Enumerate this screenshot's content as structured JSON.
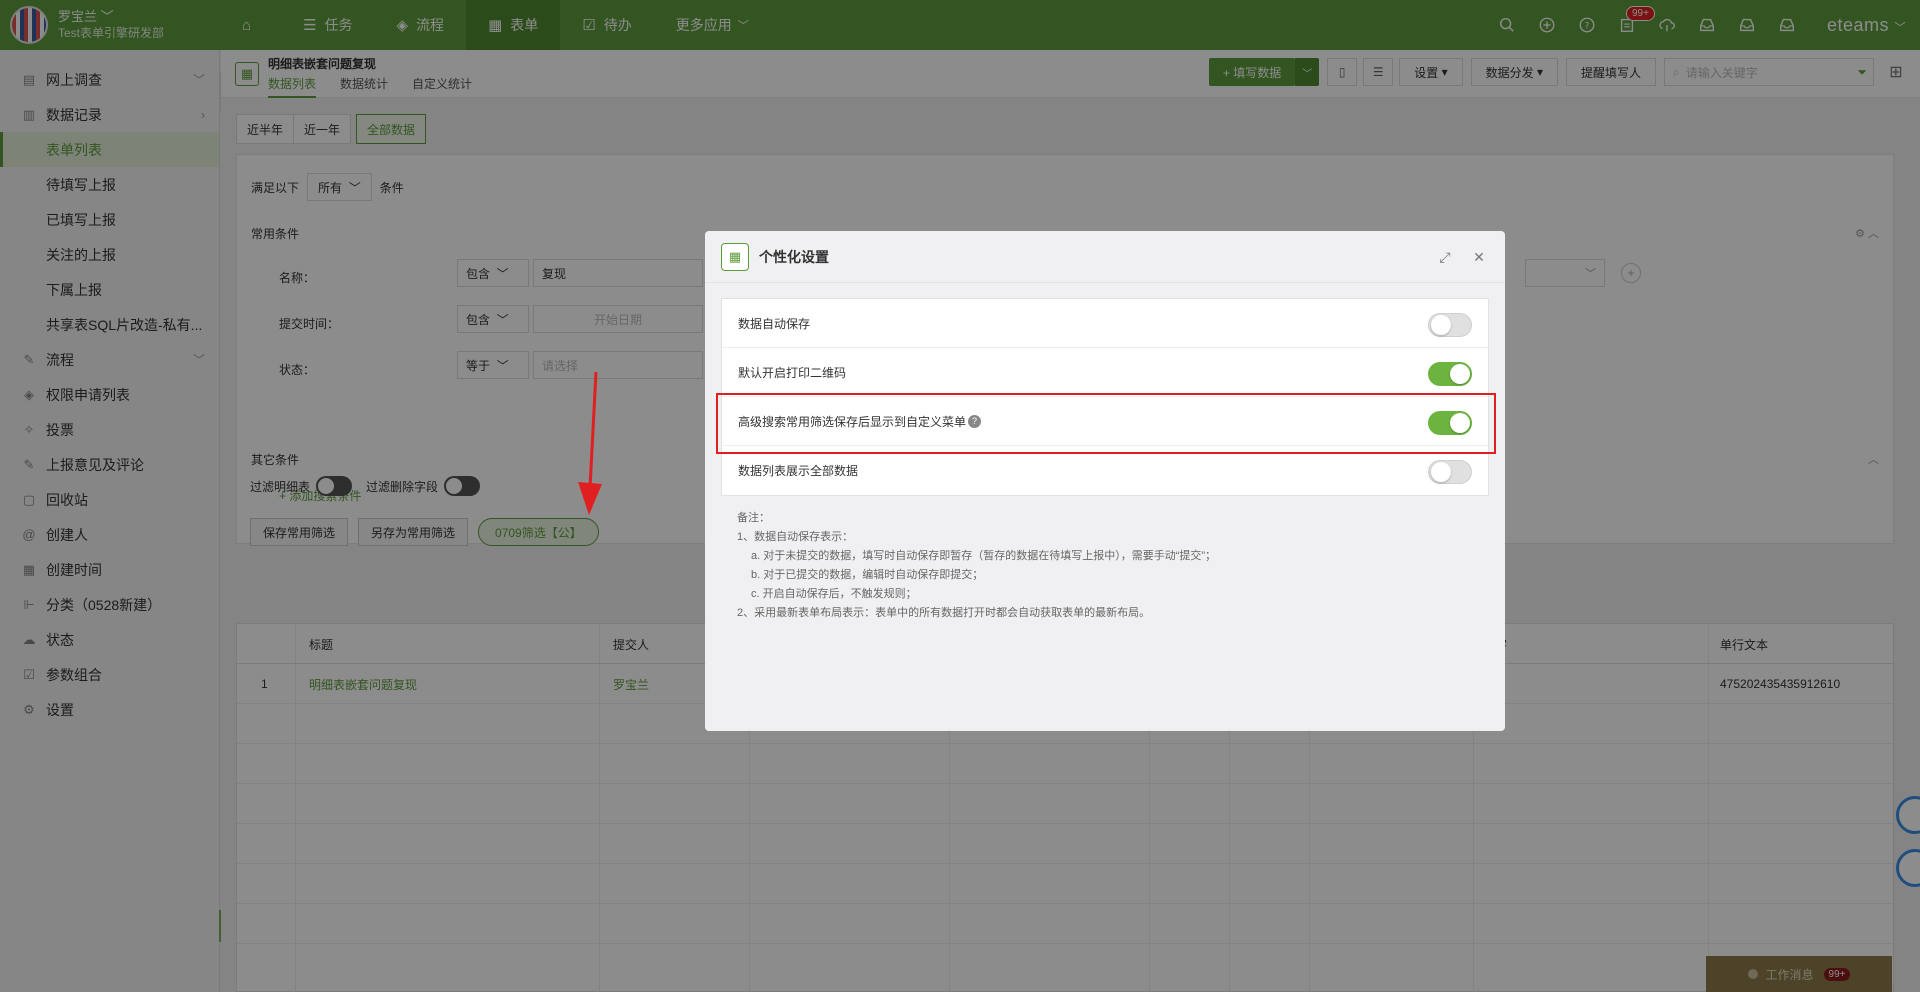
{
  "user": {
    "name": "罗宝兰",
    "dept": "Test表单引擎研发部"
  },
  "nav": [
    {
      "label": ""
    },
    {
      "label": "任务"
    },
    {
      "label": "流程"
    },
    {
      "label": "表单"
    },
    {
      "label": "待办"
    },
    {
      "label": "更多应用"
    }
  ],
  "top_badge": "99+",
  "brand": "eteams",
  "sidebar": [
    {
      "label": "网上调查",
      "icon": "survey-icon",
      "chevron": "﹀"
    },
    {
      "label": "数据记录",
      "icon": "records-icon",
      "chevron": "›"
    },
    {
      "label": "表单列表",
      "sub": true,
      "active": true
    },
    {
      "label": "待填写上报",
      "sub": true
    },
    {
      "label": "已填写上报",
      "sub": true
    },
    {
      "label": "关注的上报",
      "sub": true
    },
    {
      "label": "下属上报",
      "sub": true
    },
    {
      "label": "共享表SQL片改造-私有...",
      "sub": true
    },
    {
      "label": "流程",
      "icon": "flow-icon",
      "chevron": "﹀"
    },
    {
      "label": "权限申请列表",
      "icon": "layers-icon"
    },
    {
      "label": "投票",
      "icon": "vote-icon"
    },
    {
      "label": "上报意见及评论",
      "icon": "comment-icon"
    },
    {
      "label": "回收站",
      "icon": "trash-icon"
    },
    {
      "label": "创建人",
      "icon": "at-icon"
    },
    {
      "label": "创建时间",
      "icon": "calendar-icon"
    },
    {
      "label": "分类（0528新建）",
      "icon": "category-icon"
    },
    {
      "label": "状态",
      "icon": "cloud-icon"
    },
    {
      "label": "参数组合",
      "icon": "checkbox-icon"
    },
    {
      "label": "设置",
      "icon": "gear-icon"
    }
  ],
  "page": {
    "title": "明细表嵌套问题复现",
    "tabs": [
      "数据列表",
      "数据统计",
      "自定义统计"
    ],
    "fill_button": "+ 填写数据",
    "settings_button": "设置",
    "distribute_button": "数据分发",
    "remind_button": "提醒填写人",
    "search_placeholder": "请输入关键字"
  },
  "time_tabs": [
    "近半年",
    "近一年",
    "全部数据"
  ],
  "filter": {
    "satisfy_prefix": "满足以下",
    "satisfy_value": "所有",
    "satisfy_suffix": "条件",
    "common_title": "常用条件",
    "rows": [
      {
        "label": "名称：",
        "op": "包含",
        "value": "复现"
      },
      {
        "label": "提交时间：",
        "op": "包含",
        "value": "开始日期"
      },
      {
        "label": "状态：",
        "op": "等于",
        "value": "请选择"
      }
    ],
    "other_title": "其它条件",
    "add_condition": "+ 添加搜索条件",
    "filter_detail": "过滤明细表",
    "filter_deleted": "过滤删除字段",
    "save_common": "保存常用筛选",
    "save_as_common": "另存为常用筛选",
    "saved_filter": "0709筛选【公】"
  },
  "grid": {
    "columns": [
      "标题",
      "提交人",
      "数字",
      "单行文本"
    ],
    "rows": [
      {
        "index": "1",
        "title": "明细表嵌套问题复现",
        "submitter": "罗宝兰",
        "text": "475202435435912610"
      }
    ]
  },
  "modal": {
    "title": "个性化设置",
    "settings": [
      {
        "label": "数据自动保存",
        "on": false,
        "help": false
      },
      {
        "label": "默认开启打印二维码",
        "on": true,
        "help": false
      },
      {
        "label": "高级搜索常用筛选保存后显示到自定义菜单",
        "on": true,
        "help": true
      },
      {
        "label": "数据列表展示全部数据",
        "on": false,
        "help": false
      }
    ],
    "notes": [
      {
        "text": "备注：",
        "sub": false
      },
      {
        "text": "1、数据自动保存表示：",
        "sub": false
      },
      {
        "text": "a. 对于未提交的数据，填写时自动保存即暂存（暂存的数据在待填写上报中），需要手动“提交”；",
        "sub": true
      },
      {
        "text": "b. 对于已提交的数据，编辑时自动保存即提交；",
        "sub": true
      },
      {
        "text": "c. 开启自动保存后，不触发规则；",
        "sub": true
      },
      {
        "text": "2、采用最新表单布局表示：表单中的所有数据打开时都会自动获取表单的最新布局。",
        "sub": false
      }
    ]
  },
  "work_msg": {
    "label": "工作消息",
    "count": "99+"
  },
  "colors": {
    "brand_green": "#5d9c3c",
    "highlight_red": "#e02020",
    "switch_on": "#6db33f"
  }
}
